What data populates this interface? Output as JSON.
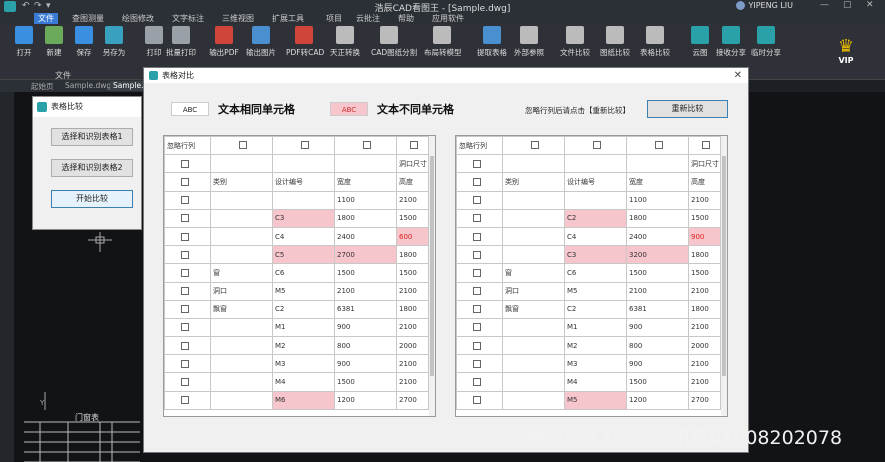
{
  "app": {
    "title": "浩辰CAD看图王 - [Sample.dwg]",
    "user": "YIPENG LIU",
    "window_controls": [
      "—",
      "▢",
      "✕"
    ]
  },
  "menu": [
    "文件",
    "查图测量",
    "绘图修改",
    "文字标注",
    "三维视图",
    "扩展工具",
    "项目",
    "云批注",
    "帮助",
    "应用软件"
  ],
  "ribbon": {
    "buttons": [
      {
        "label": "打开",
        "color": "#3a8fe0"
      },
      {
        "label": "新建",
        "color": "#6aaa5a"
      },
      {
        "label": "保存",
        "color": "#3a8fe0"
      },
      {
        "label": "另存为",
        "color": "#3aa0c0"
      },
      {
        "label": "打印",
        "color": "#9aa0a8"
      },
      {
        "label": "批量打印",
        "color": "#9aa0a8"
      },
      {
        "label": "输出PDF",
        "color": "#d0453a"
      },
      {
        "label": "输出图片",
        "color": "#4a8fd0"
      },
      {
        "label": "PDF转CAD",
        "color": "#d0453a"
      },
      {
        "label": "天正转换",
        "color": "#bbb"
      },
      {
        "label": "CAD图纸分割",
        "color": "#bbb"
      },
      {
        "label": "布局转模型",
        "color": "#bbb"
      },
      {
        "label": "提取表格",
        "color": "#4a8fd0"
      },
      {
        "label": "外部参照",
        "color": "#bbb"
      },
      {
        "label": "文件比较",
        "color": "#bbb"
      },
      {
        "label": "图纸比较",
        "color": "#bbb"
      },
      {
        "label": "表格比较",
        "color": "#bbb"
      },
      {
        "label": "云图",
        "color": "#2aa1a8"
      },
      {
        "label": "接收分享",
        "color": "#2aa1a8"
      },
      {
        "label": "临时分享",
        "color": "#2aa1a8"
      }
    ],
    "group_label": "文件",
    "vip_label": "VIP"
  },
  "doc_tabs": [
    "起始页",
    "Sample.dwg",
    "Sample.dw"
  ],
  "small_dialog": {
    "title": "表格比较",
    "buttons": [
      "选择和识别表格1",
      "选择和识别表格2",
      "开始比较"
    ]
  },
  "compare_dialog": {
    "title": "表格对比",
    "same_swatch": "ABC",
    "same_label": "文本相同单元格",
    "diff_swatch": "ABC",
    "diff_label": "文本不同单元格",
    "hint": "忽略行列后请点击【重新比较】",
    "recompare_button": "重新比较",
    "ignore_label": "忽略行列",
    "left_table": [
      [
        "",
        "",
        "",
        "",
        "洞口尺寸"
      ],
      [
        "",
        "类别",
        "设计编号",
        "宽度",
        "高度"
      ],
      [
        "",
        "",
        "",
        "1100",
        "2100"
      ],
      [
        "",
        "",
        "C3",
        "1800",
        "1500"
      ],
      [
        "",
        "",
        "C4",
        "2400",
        "600"
      ],
      [
        "",
        "",
        "C5",
        "2700",
        "1800"
      ],
      [
        "",
        "窗",
        "C6",
        "1500",
        "1500"
      ],
      [
        "",
        "洞口",
        "M5",
        "2100",
        "2100"
      ],
      [
        "",
        "飘窗",
        "C2",
        "6381",
        "1800"
      ],
      [
        "",
        "",
        "M1",
        "900",
        "2100"
      ],
      [
        "",
        "",
        "M2",
        "800",
        "2000"
      ],
      [
        "",
        "",
        "M3",
        "900",
        "2100"
      ],
      [
        "",
        "",
        "M4",
        "1500",
        "2100"
      ],
      [
        "",
        "",
        "M6",
        "1200",
        "2700"
      ]
    ],
    "right_table": [
      [
        "",
        "",
        "",
        "",
        "洞口尺寸"
      ],
      [
        "",
        "类别",
        "设计编号",
        "宽度",
        "高度"
      ],
      [
        "",
        "",
        "",
        "1100",
        "2100"
      ],
      [
        "",
        "",
        "C2",
        "1800",
        "1500"
      ],
      [
        "",
        "",
        "C4",
        "2400",
        "900"
      ],
      [
        "",
        "",
        "C3",
        "3200",
        "1800"
      ],
      [
        "",
        "窗",
        "C6",
        "1500",
        "1500"
      ],
      [
        "",
        "洞口",
        "M5",
        "2100",
        "2100"
      ],
      [
        "",
        "飘窗",
        "C2",
        "6381",
        "1800"
      ],
      [
        "",
        "",
        "M1",
        "900",
        "2100"
      ],
      [
        "",
        "",
        "M2",
        "800",
        "2000"
      ],
      [
        "",
        "",
        "M3",
        "900",
        "2100"
      ],
      [
        "",
        "",
        "M4",
        "1500",
        "2100"
      ],
      [
        "",
        "",
        "M5",
        "1200",
        "2700"
      ]
    ],
    "diff_cells": [
      [
        3,
        2
      ],
      [
        4,
        4
      ],
      [
        5,
        2
      ],
      [
        5,
        3
      ],
      [
        13,
        2
      ]
    ],
    "diff_red_cells": [
      [
        4,
        4
      ]
    ]
  },
  "drawing_label": "门窗表",
  "watermark": "掘金技术社区 @ 用户01008202078"
}
